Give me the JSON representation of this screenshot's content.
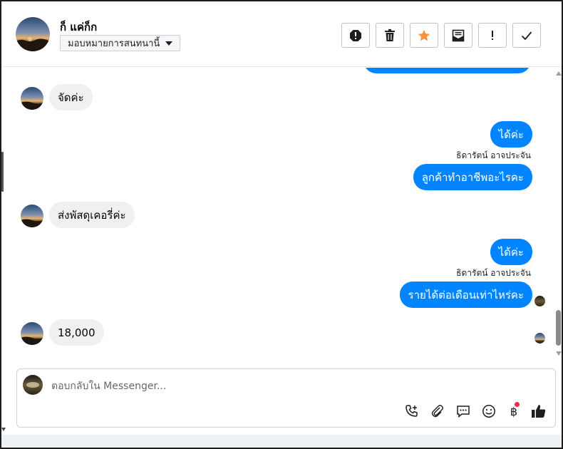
{
  "header": {
    "contact_name": "ก็ แค่ก็ก",
    "assign_label": "มอบหมายการสนทนานี้",
    "actions": [
      {
        "name": "report-spam",
        "icon": "alert-octagon-icon"
      },
      {
        "name": "delete",
        "icon": "trash-icon"
      },
      {
        "name": "star",
        "icon": "star-icon",
        "color": "#f7923b"
      },
      {
        "name": "mark-unread",
        "icon": "envelope-icon"
      },
      {
        "name": "follow-up",
        "icon": "exclamation-icon"
      },
      {
        "name": "mark-done",
        "icon": "checkmark-icon"
      }
    ]
  },
  "messages": [
    {
      "direction": "in",
      "text": "จัดค่ะ"
    },
    {
      "direction": "out",
      "text": "ได้ค่ะ"
    },
    {
      "direction": "out",
      "sender": "ธิดารัตน์ อาจประจัน",
      "text": "ลูกค้าทำอาชีพอะไรคะ"
    },
    {
      "direction": "in",
      "text": "ส่งพัสดุเคอรี่ค่ะ"
    },
    {
      "direction": "out",
      "text": "ได้ค่ะ"
    },
    {
      "direction": "out",
      "sender": "ธิดารัตน์ อาจประจัน",
      "text": "รายได้ต่อเดือนเท่าไหร่คะ"
    },
    {
      "direction": "in",
      "text": "18,000"
    }
  ],
  "composer": {
    "placeholder": "ตอบกลับใน Messenger...",
    "value": "",
    "tools": [
      "phone-plus-icon",
      "paperclip-icon",
      "saved-reply-icon",
      "emoji-icon",
      "baht-payment-icon",
      "thumbs-up-icon"
    ],
    "baht_symbol": "฿"
  },
  "colors": {
    "outgoing_bubble": "#0084ff",
    "incoming_bubble": "#f0f0f0",
    "star": "#f7923b",
    "notification": "#f02849"
  }
}
